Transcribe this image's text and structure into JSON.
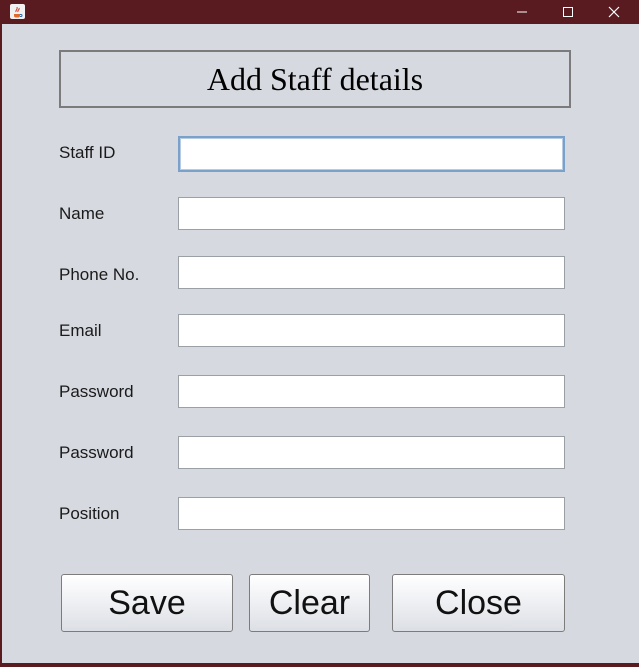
{
  "window": {
    "title": "",
    "controls": {
      "minimize_icon": "minimize-icon",
      "maximize_icon": "maximize-icon",
      "close_icon": "close-icon"
    }
  },
  "form": {
    "title": "Add Staff details",
    "fields": [
      {
        "label": "Staff ID",
        "value": ""
      },
      {
        "label": "Name",
        "value": ""
      },
      {
        "label": "Phone No.",
        "value": ""
      },
      {
        "label": "Email",
        "value": ""
      },
      {
        "label": "Password",
        "value": ""
      },
      {
        "label": "Password",
        "value": ""
      },
      {
        "label": "Position",
        "value": ""
      }
    ]
  },
  "buttons": {
    "save": "Save",
    "clear": "Clear",
    "close": "Close"
  },
  "colors": {
    "titlebar": "#5a1b20",
    "background": "#d6d9e0",
    "focus_border": "#7aa1c9"
  }
}
